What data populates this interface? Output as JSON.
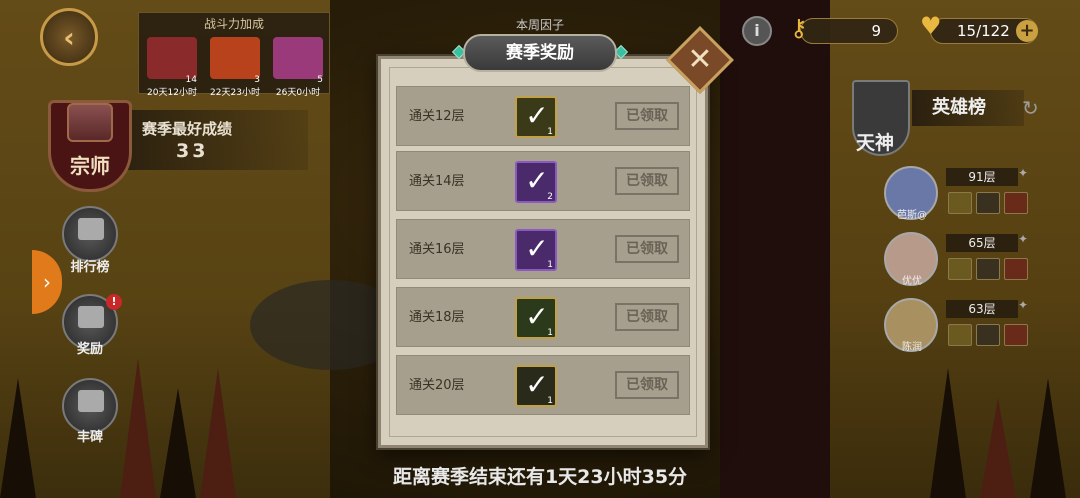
{
  "top_left": {
    "buff_title": "战斗力加成",
    "buffs": [
      {
        "count": "14",
        "time": "20天12小时",
        "color": "#8a2a2a"
      },
      {
        "count": "3",
        "time": "22天23小时",
        "color": "#b8421c"
      },
      {
        "count": "5",
        "time": "26天0小时",
        "color": "#9a3a7a"
      }
    ],
    "rank_name": "宗师",
    "best_label": "赛季最好成绩",
    "best_value": "33"
  },
  "side_buttons": [
    {
      "label": "排行榜",
      "badge": ""
    },
    {
      "label": "奖励",
      "badge": "!"
    },
    {
      "label": "丰碑",
      "badge": ""
    }
  ],
  "top_right": {
    "info": "i",
    "keys": "9",
    "stamina": "15/122",
    "plus": "+"
  },
  "hero_board": {
    "god_name": "天神",
    "tab_label": "英雄榜",
    "heroes": [
      {
        "name": "芭斯@",
        "floor": "91层",
        "color": "#6a78a8"
      },
      {
        "name": "优优",
        "floor": "65层",
        "color": "#b89a8a"
      },
      {
        "name": "陈润",
        "floor": "63层",
        "color": "#a89060"
      }
    ]
  },
  "modal": {
    "factor_label": "本周因子",
    "title": "赛季奖励",
    "rows": [
      {
        "label": "通关12层",
        "qty": "1",
        "status": "已领取",
        "icon_color": "#3a3a18",
        "rarity": "gold"
      },
      {
        "label": "通关14层",
        "qty": "2",
        "status": "已领取",
        "icon_color": "#4a2a6a",
        "rarity": "purple"
      },
      {
        "label": "通关16层",
        "qty": "1",
        "status": "已领取",
        "icon_color": "#4a2a6a",
        "rarity": "purple"
      },
      {
        "label": "通关18层",
        "qty": "1",
        "status": "已领取",
        "icon_color": "#2a3a1a",
        "rarity": "gold"
      },
      {
        "label": "通关20层",
        "qty": "1",
        "status": "已领取",
        "icon_color": "#2a2a1a",
        "rarity": "gold"
      }
    ]
  },
  "season_countdown": "距离赛季结束还有1天23小时35分"
}
